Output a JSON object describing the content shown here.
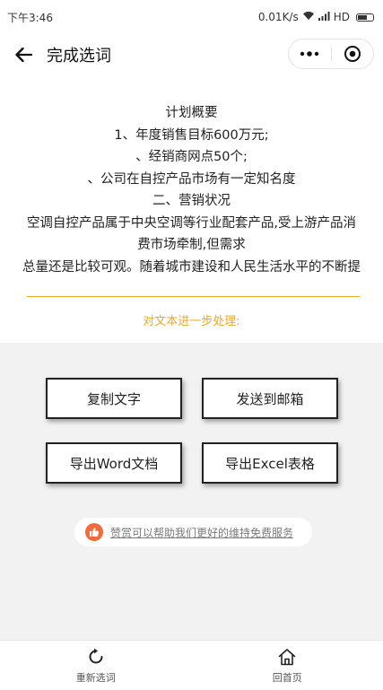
{
  "status": {
    "time": "下午3:46",
    "network": "0.01K/s",
    "signal": "HD"
  },
  "nav": {
    "title": "完成选词"
  },
  "content": {
    "lines": [
      "计划概要",
      "1、年度销售目标600万元;",
      "、经销商网点50个;",
      "、公司在自控产品市场有一定知名度",
      "二、营销状况",
      "空调自控产品属于中央空调等行业配套产品,受上游产品消",
      "费市场牵制,但需求",
      "总量还是比较可观。随着城市建设和人民生活水平的不断提"
    ],
    "process_label": "对文本进一步处理:"
  },
  "actions": {
    "copy": "复制文字",
    "email": "发送到邮箱",
    "word": "导出Word文档",
    "excel": "导出Excel表格"
  },
  "reward": {
    "text": "赞赏可以帮助我们更好的维持免费服务"
  },
  "tabs": {
    "reselect": "重新选词",
    "home": "回首页"
  },
  "colors": {
    "accent": "#f0a820",
    "reward_icon": "#f26b3a"
  }
}
